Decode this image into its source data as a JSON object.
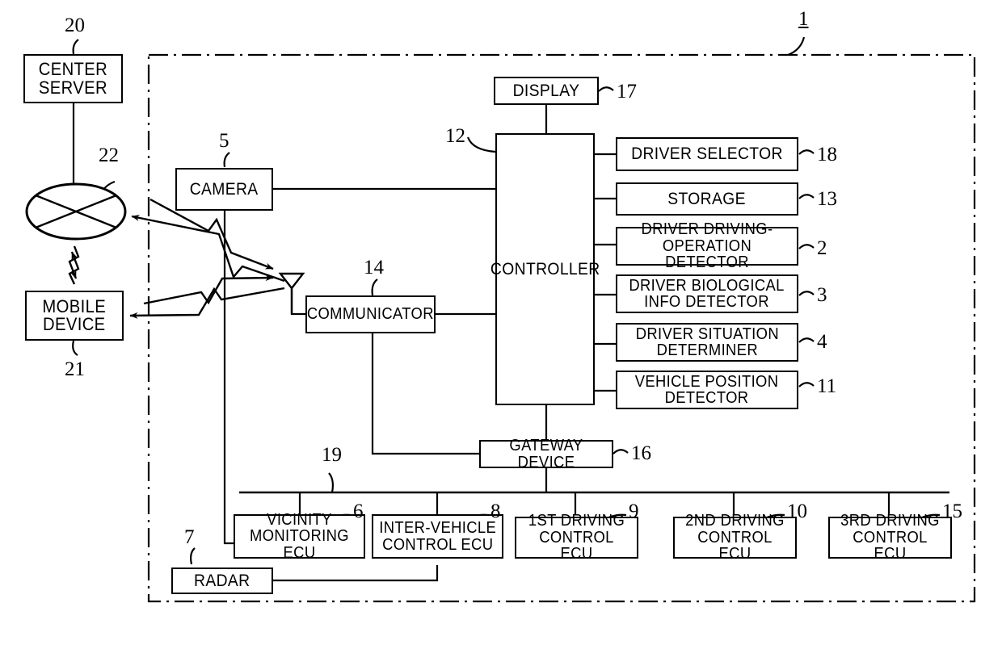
{
  "figure": {
    "kind": "patent-block-diagram",
    "system_ref": "1",
    "boundary_style": "dash-dot rectangle (vehicle boundary)"
  },
  "blocks": {
    "center_server": {
      "label": "CENTER\nSERVER",
      "ref": "20"
    },
    "base_station": {
      "label": "",
      "ref": "22",
      "icon": "antenna-ellipse-icon"
    },
    "mobile_device": {
      "label": "MOBILE\nDEVICE",
      "ref": "21"
    },
    "camera": {
      "label": "CAMERA",
      "ref": "5"
    },
    "communicator": {
      "label": "COMMUNICATOR",
      "ref": "14"
    },
    "antenna": {
      "label": "",
      "ref": "",
      "icon": "antenna-icon"
    },
    "display": {
      "label": "DISPLAY",
      "ref": "17"
    },
    "controller": {
      "label": "CONTROLLER",
      "ref": "12"
    },
    "driver_selector": {
      "label": "DRIVER SELECTOR",
      "ref": "18"
    },
    "storage": {
      "label": "STORAGE",
      "ref": "13"
    },
    "driving_op_detector": {
      "label": "DRIVER DRIVING-\nOPERATION DETECTOR",
      "ref": "2"
    },
    "bio_info_detector": {
      "label": "DRIVER BIOLOGICAL\nINFO DETECTOR",
      "ref": "3"
    },
    "situation_determiner": {
      "label": "DRIVER SITUATION\nDETERMINER",
      "ref": "4"
    },
    "vehicle_pos_detector": {
      "label": "VEHICLE POSITION\nDETECTOR",
      "ref": "11"
    },
    "gateway_device": {
      "label": "GATEWAY DEVICE",
      "ref": "16"
    },
    "bus": {
      "label": "",
      "ref": "19"
    },
    "radar": {
      "label": "RADAR",
      "ref": "7"
    },
    "vicinity_ecu": {
      "label": "VICINITY\nMONITORING ECU",
      "ref": "6"
    },
    "inter_vehicle_ecu": {
      "label": "INTER-VEHICLE\nCONTROL ECU",
      "ref": "8"
    },
    "driving_ecu_1": {
      "label": "1ST DRIVING\nCONTROL ECU",
      "ref": "9"
    },
    "driving_ecu_2": {
      "label": "2ND DRIVING\nCONTROL ECU",
      "ref": "10"
    },
    "driving_ecu_3": {
      "label": "3RD DRIVING\nCONTROL ECU",
      "ref": "15"
    }
  },
  "colors": {
    "line": "#000000",
    "background": "#ffffff"
  }
}
